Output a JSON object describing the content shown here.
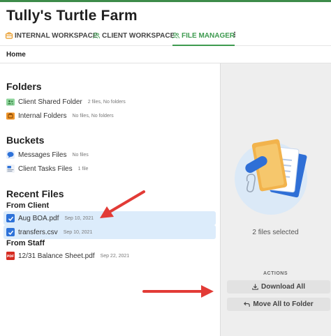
{
  "app": {
    "title": "Tully's Turtle Farm"
  },
  "tabs": [
    {
      "label": "INTERNAL WORKSPACE",
      "icon": "briefcase-icon"
    },
    {
      "label": "CLIENT WORKSPACE",
      "icon": "users-icon"
    },
    {
      "label": "FILE MANAGER",
      "icon": "users-icon",
      "active": true
    }
  ],
  "tab_more": "⋮",
  "breadcrumb": {
    "home": "Home"
  },
  "folders": {
    "title": "Folders",
    "items": [
      {
        "name": "Client Shared Folder",
        "meta": "2 files, No folders",
        "icon": "shared-folder-icon"
      },
      {
        "name": "Internal Folders",
        "meta": "No files, No folders",
        "icon": "internal-folder-icon"
      }
    ]
  },
  "buckets": {
    "title": "Buckets",
    "items": [
      {
        "name": "Messages Files",
        "meta": "No files",
        "icon": "chat-bubble-icon"
      },
      {
        "name": "Client Tasks Files",
        "meta": "1 file",
        "icon": "task-list-icon"
      }
    ]
  },
  "recent": {
    "title": "Recent Files",
    "from_client": "From Client",
    "client_files": [
      {
        "name": "Aug BOA.pdf",
        "date": "Sep 10, 2021",
        "checked": true
      },
      {
        "name": "transfers.csv",
        "date": "Sep 10, 2021",
        "checked": true
      }
    ],
    "from_staff": "From Staff",
    "staff_files": [
      {
        "name": "12/31 Balance Sheet.pdf",
        "date": "Sep 22, 2021",
        "icon": "pdf-icon"
      }
    ]
  },
  "panel": {
    "selection": "2 files selected",
    "actions_label": "ACTIONS",
    "download_all": "Download All",
    "move_all": "Move All to Folder"
  },
  "colors": {
    "brand_green": "#3d9a4f",
    "selection_bg": "#dcecfb",
    "check_blue": "#2d72d9",
    "annotation_red": "#e23b36"
  }
}
